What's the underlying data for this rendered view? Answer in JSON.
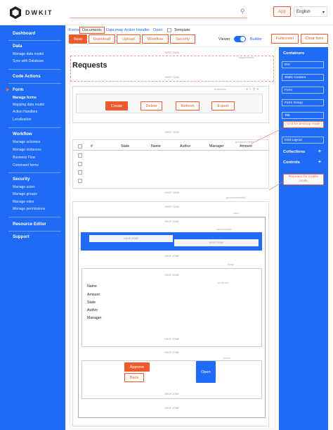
{
  "brand": {
    "name": "DWKIT"
  },
  "topbar": {
    "search_icon": "search-icon",
    "app_label": "App",
    "language": "English"
  },
  "sidebar": {
    "dashboard": "Dashboard",
    "data": {
      "title": "Data",
      "items": [
        "Manage data model",
        "Sync with Database"
      ]
    },
    "code_actions": "Code Actions",
    "form": {
      "title": "Form",
      "items": [
        "Manage forms",
        "Mapping data model",
        "Action Handlers",
        "Localization"
      ]
    },
    "workflow": {
      "title": "Workflow",
      "items": [
        "Manage schemes",
        "Manage instances",
        "Business Flow",
        "Command forms"
      ]
    },
    "security": {
      "title": "Security",
      "items": [
        "Manage users",
        "Manage groups",
        "Manage roles",
        "Manage permissions"
      ]
    },
    "resource_editor": "Resource Editor",
    "support": "Support"
  },
  "breadcrumbs": {
    "forms": "Forms",
    "documents": "Documents",
    "data_map": "Data map",
    "action_handler": "Action Handler",
    "open": "Open",
    "template": "Template"
  },
  "toolbar": {
    "save": "Save",
    "download": "Download",
    "upload": "Upload",
    "workflow": "Workflow",
    "security": "Security",
    "viewer": "Viewer",
    "builder": "Builder",
    "fullscreen": "Fullscreen",
    "clear_form": "Clear form"
  },
  "form": {
    "title": "Requests",
    "drop_zone": "DROP ZONE",
    "header_ctrl": "pageheader",
    "buttons_ctrl": "buttonbar",
    "buttons": [
      "Create",
      "Delete",
      "Refresh",
      "Export"
    ],
    "grid_ctrl": "griddocuments",
    "grid_columns": [
      "#",
      "State",
      "Name",
      "Author",
      "Manager",
      "Amount"
    ],
    "grid_ctrl2": "griddocuments2",
    "card_ctrl": "card",
    "card_header_ctrl": "card-header",
    "body_ctrl": "body",
    "body_ctrl2": "body-ctrl",
    "fields": [
      "Name",
      "Amount",
      "State",
      "Author",
      "Manager"
    ],
    "footer_ctrl": "footer",
    "approve": "Approve",
    "back": "Back",
    "open_btn": "Open"
  },
  "right_panel": {
    "containers": "Containers",
    "items": [
      "DIV",
      "Static Content",
      "Form",
      "Form Group",
      "Tab",
      "Grid Layout"
    ],
    "collections": "Collections",
    "controls": "Controls"
  },
  "annotations": {
    "desktop": "Grid for desktop mode",
    "mobile": "Repeater for mobile mode"
  },
  "colors": {
    "accent": "#ee5a2c",
    "sidebar": "#1f6bf5"
  }
}
